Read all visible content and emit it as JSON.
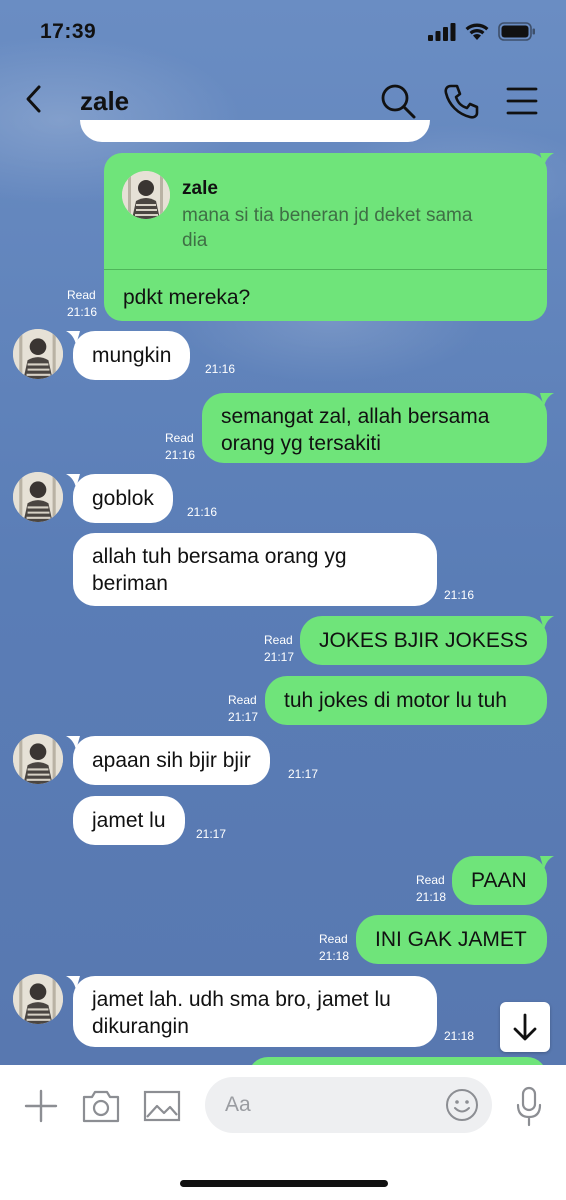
{
  "status_bar": {
    "time": "17:39",
    "battery": "battery-icon",
    "wifi": "wifi-icon",
    "signal": "signal-icon"
  },
  "header": {
    "title": "zale"
  },
  "quote": {
    "author": "zale",
    "text_line1": "mana si tia beneran jd deket sama",
    "text_line2": "dia",
    "reply": "pdkt mereka?",
    "read": "Read",
    "time": "21:16"
  },
  "messages": [
    {
      "from": "them",
      "text": "mungkin",
      "time": "21:16"
    },
    {
      "from": "me",
      "line1": "semangat zal, allah bersama",
      "line2": "orang yg tersakiti",
      "read": "Read",
      "time": "21:16"
    },
    {
      "from": "them",
      "text": "goblok",
      "time": "21:16"
    },
    {
      "from": "them",
      "line1": "allah tuh bersama orang yg",
      "line2": "beriman",
      "time": "21:16"
    },
    {
      "from": "me",
      "text": "JOKES BJIR JOKESS",
      "read": "Read",
      "time": "21:17"
    },
    {
      "from": "me",
      "text": "tuh jokes di motor lu tuh",
      "read": "Read",
      "time": "21:17"
    },
    {
      "from": "them",
      "text": "apaan sih bjir bjir",
      "time": "21:17"
    },
    {
      "from": "them",
      "text": "jamet lu",
      "time": "21:17"
    },
    {
      "from": "me",
      "text": "PAAN",
      "read": "Read",
      "time": "21:18"
    },
    {
      "from": "me",
      "text": "INI GAK JAMET",
      "read": "Read",
      "time": "21:18"
    },
    {
      "from": "them",
      "line1": "jamet lah. udh sma bro, jamet lu",
      "line2": "dikurangin",
      "time": "21:18"
    }
  ],
  "input": {
    "placeholder": "Aa"
  },
  "colors": {
    "my_bubble": "#6fe47a",
    "their_bubble": "#ffffff",
    "background": "#5b7fb6"
  }
}
